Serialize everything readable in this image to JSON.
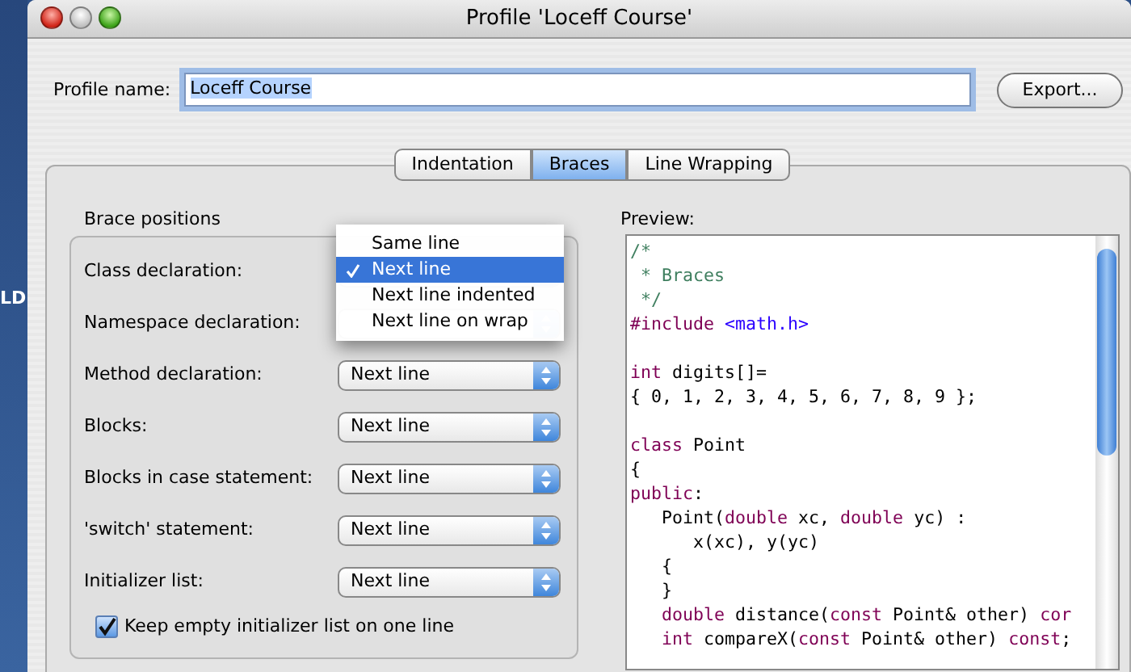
{
  "desktop": {
    "text": "LD"
  },
  "window": {
    "title": "Profile 'Loceff Course'"
  },
  "profile_name": {
    "label": "Profile name:",
    "value": "Loceff Course"
  },
  "export_button": "Export...",
  "tabs": [
    {
      "label": "Indentation",
      "selected": false
    },
    {
      "label": "Braces",
      "selected": true
    },
    {
      "label": "Line Wrapping",
      "selected": false
    }
  ],
  "brace_positions": {
    "title": "Brace positions",
    "rows": [
      {
        "label": "Class declaration:"
      },
      {
        "label": "Namespace declaration:"
      },
      {
        "label": "Method declaration:",
        "value": "Next line"
      },
      {
        "label": "Blocks:",
        "value": "Next line"
      },
      {
        "label": "Blocks in case statement:",
        "value": "Next line"
      },
      {
        "label": "'switch' statement:",
        "value": "Next line"
      },
      {
        "label": "Initializer list:",
        "value": "Next line"
      }
    ],
    "checkbox": {
      "label": "Keep empty initializer list on one line",
      "checked": true
    }
  },
  "popup_menu": {
    "items": [
      {
        "label": "Same line",
        "selected": false
      },
      {
        "label": "Next line",
        "selected": true
      },
      {
        "label": "Next line indented",
        "selected": false
      },
      {
        "label": "Next line on wrap",
        "selected": false
      }
    ]
  },
  "preview": {
    "title": "Preview:",
    "lines": [
      {
        "kind": "code",
        "segments": [
          {
            "kind": "comment",
            "text": "/*"
          }
        ]
      },
      {
        "kind": "code",
        "segments": [
          {
            "kind": "comment",
            "text": " * Braces"
          }
        ]
      },
      {
        "kind": "code",
        "segments": [
          {
            "kind": "comment",
            "text": " */"
          }
        ]
      },
      {
        "kind": "code",
        "segments": [
          {
            "kind": "keyword",
            "text": "#include"
          },
          {
            "kind": "string",
            "text": " <math.h>"
          }
        ]
      },
      {
        "kind": "blank"
      },
      {
        "kind": "code",
        "segments": [
          {
            "kind": "keyword",
            "text": "int"
          },
          {
            "kind": "plain",
            "text": " digits[]="
          }
        ]
      },
      {
        "kind": "code",
        "segments": [
          {
            "kind": "plain",
            "text": "{ 0, 1, 2, 3, 4, 5, 6, 7, 8, 9 };"
          }
        ]
      },
      {
        "kind": "blank"
      },
      {
        "kind": "code",
        "segments": [
          {
            "kind": "keyword",
            "text": "class"
          },
          {
            "kind": "plain",
            "text": " Point"
          }
        ]
      },
      {
        "kind": "code",
        "segments": [
          {
            "kind": "plain",
            "text": "{"
          }
        ]
      },
      {
        "kind": "code",
        "segments": [
          {
            "kind": "keyword",
            "text": "public"
          },
          {
            "kind": "plain",
            "text": ":"
          }
        ]
      },
      {
        "kind": "code",
        "segments": [
          {
            "kind": "plain",
            "text": "   Point("
          },
          {
            "kind": "keyword",
            "text": "double"
          },
          {
            "kind": "plain",
            "text": " xc, "
          },
          {
            "kind": "keyword",
            "text": "double"
          },
          {
            "kind": "plain",
            "text": " yc) :"
          }
        ]
      },
      {
        "kind": "code",
        "segments": [
          {
            "kind": "plain",
            "text": "      x(xc), y(yc)"
          }
        ]
      },
      {
        "kind": "code",
        "segments": [
          {
            "kind": "plain",
            "text": "   {"
          }
        ]
      },
      {
        "kind": "code",
        "segments": [
          {
            "kind": "plain",
            "text": "   }"
          }
        ]
      },
      {
        "kind": "code",
        "segments": [
          {
            "kind": "keyword",
            "text": "   double"
          },
          {
            "kind": "plain",
            "text": " distance("
          },
          {
            "kind": "keyword",
            "text": "const"
          },
          {
            "kind": "plain",
            "text": " Point& other) "
          },
          {
            "kind": "keyword",
            "text": "cor"
          }
        ]
      },
      {
        "kind": "code",
        "segments": [
          {
            "kind": "keyword",
            "text": "   int"
          },
          {
            "kind": "plain",
            "text": " compareX("
          },
          {
            "kind": "keyword",
            "text": "const"
          },
          {
            "kind": "plain",
            "text": " Point& other) "
          },
          {
            "kind": "keyword",
            "text": "const"
          },
          {
            "kind": "plain",
            "text": ";"
          }
        ]
      }
    ]
  }
}
